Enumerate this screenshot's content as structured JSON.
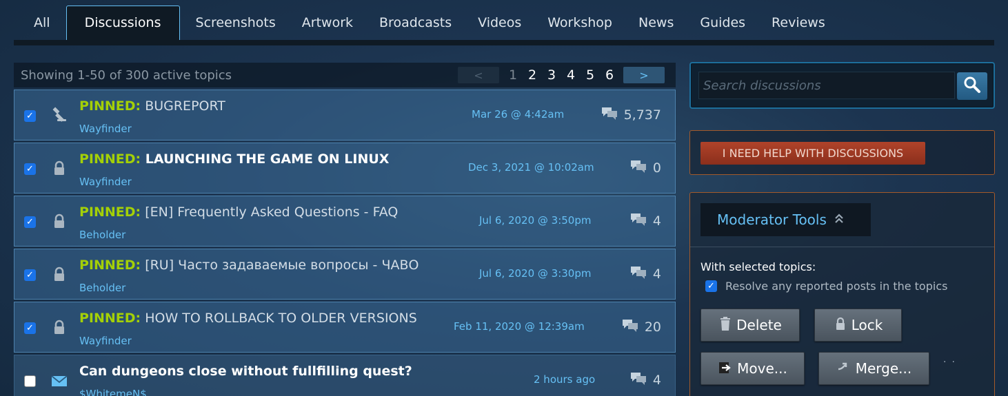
{
  "tabs": [
    {
      "label": "All"
    },
    {
      "label": "Discussions",
      "active": true
    },
    {
      "label": "Screenshots"
    },
    {
      "label": "Artwork"
    },
    {
      "label": "Broadcasts"
    },
    {
      "label": "Videos"
    },
    {
      "label": "Workshop"
    },
    {
      "label": "News"
    },
    {
      "label": "Guides"
    },
    {
      "label": "Reviews"
    }
  ],
  "list_header": {
    "showing": "Showing 1-50 of 300 active topics",
    "prev": "<",
    "next": ">",
    "pages": [
      "1",
      "2",
      "3",
      "4",
      "5",
      "6"
    ],
    "current_page": "1"
  },
  "topics": [
    {
      "pin_label": "PINNED:",
      "title": " BUGREPORT",
      "author": "Wayfinder",
      "date": "Mar 26 @ 4:42am",
      "replies": "5,737",
      "checked": true,
      "icon": "gavel-icon"
    },
    {
      "pin_label": "PINNED:",
      "title": " LAUNCHING THE GAME ON LINUX",
      "author": "Wayfinder",
      "date": "Dec 3, 2021 @ 10:02am",
      "replies": "0",
      "checked": true,
      "icon": "lock-icon"
    },
    {
      "pin_label": "PINNED:",
      "title": " [EN] Frequently Asked Questions - FAQ",
      "author": "Beholder",
      "date": "Jul 6, 2020 @ 3:50pm",
      "replies": "4",
      "checked": true,
      "icon": "lock-icon"
    },
    {
      "pin_label": "PINNED:",
      "title": " [RU] Часто задаваемые вопросы - ЧАВО",
      "author": "Beholder",
      "date": "Jul 6, 2020 @ 3:30pm",
      "replies": "4",
      "checked": true,
      "icon": "lock-icon"
    },
    {
      "pin_label": "PINNED:",
      "title": " HOW TO ROLLBACK TO OLDER VERSIONS",
      "author": "Wayfinder",
      "date": "Feb 11, 2020 @ 12:39am",
      "replies": "20",
      "checked": true,
      "icon": "lock-icon"
    },
    {
      "pin_label": "",
      "title": "Can dungeons close without fullfilling quest?",
      "author": "$WhitemeN$",
      "date": "2 hours ago",
      "replies": "4",
      "checked": false,
      "icon": "envelope-icon"
    }
  ],
  "search": {
    "placeholder": "Search discussions"
  },
  "help": {
    "label": "I NEED HELP WITH DISCUSSIONS"
  },
  "moderator": {
    "title": "Moderator Tools",
    "with_selected": "With selected topics:",
    "resolve_label": "Resolve any reported posts in the topics",
    "buttons": {
      "delete": "Delete",
      "lock": "Lock",
      "move": "Move...",
      "merge": "Merge..."
    }
  },
  "colors": {
    "accent": "#66c0f4",
    "pinned": "#a4d007",
    "help_button": "#b0432a"
  }
}
